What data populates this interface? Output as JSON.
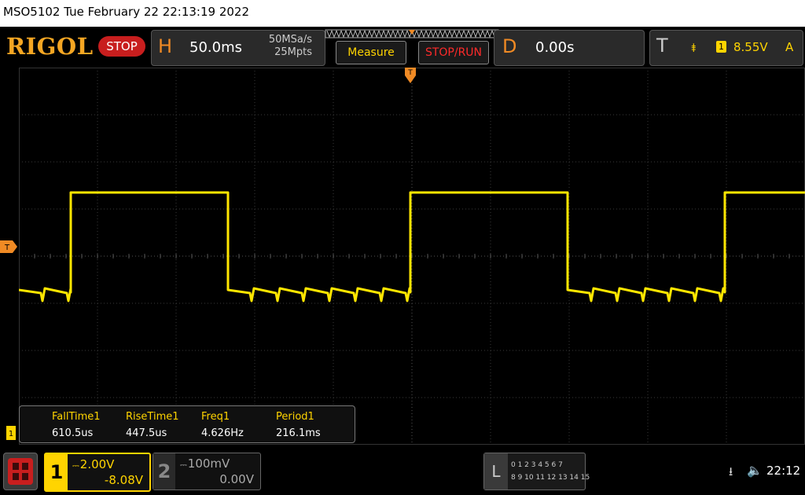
{
  "title": "MSO5102  Tue February 22 22:13:19 2022",
  "header": {
    "brand": "RIGOL",
    "run_state": "STOP",
    "horizontal": {
      "letter": "H",
      "timebase": "50.0ms",
      "sample_rate": "50MSa/s",
      "memory_depth": "25Mpts"
    },
    "measure_label": "Measure",
    "stoprun_label": "STOP/RUN",
    "delay": {
      "letter": "D",
      "value": "0.00s"
    },
    "trigger": {
      "letter": "T",
      "edge": "⯒",
      "source": "1",
      "level": "8.55V",
      "mode": "A"
    }
  },
  "scope": {
    "trigger_marker": "T",
    "channel_marker": "1"
  },
  "measurements": [
    {
      "label": "FallTime1",
      "value": "610.5us"
    },
    {
      "label": "RiseTime1",
      "value": "447.5us"
    },
    {
      "label": "Freq1",
      "value": "4.626Hz"
    },
    {
      "label": "Period1",
      "value": "216.1ms"
    }
  ],
  "channels": [
    {
      "num": "1",
      "coupling": "DC",
      "scale": "2.00V",
      "offset": "-8.08V",
      "active": true
    },
    {
      "num": "2",
      "coupling": "DC",
      "scale": "100mV",
      "offset": "0.00V",
      "active": false
    }
  ],
  "logic": {
    "letter": "L",
    "row1": "0 1 2 3  4 5 6 7",
    "row2": "8 9 10 11 12 13 14 15"
  },
  "status": {
    "usb": "⭳",
    "sound": "🔈",
    "time": "22:12"
  },
  "colors": {
    "trace": "#ffe600",
    "accent": "#f08a24",
    "grid": "#3a3a3a"
  }
}
